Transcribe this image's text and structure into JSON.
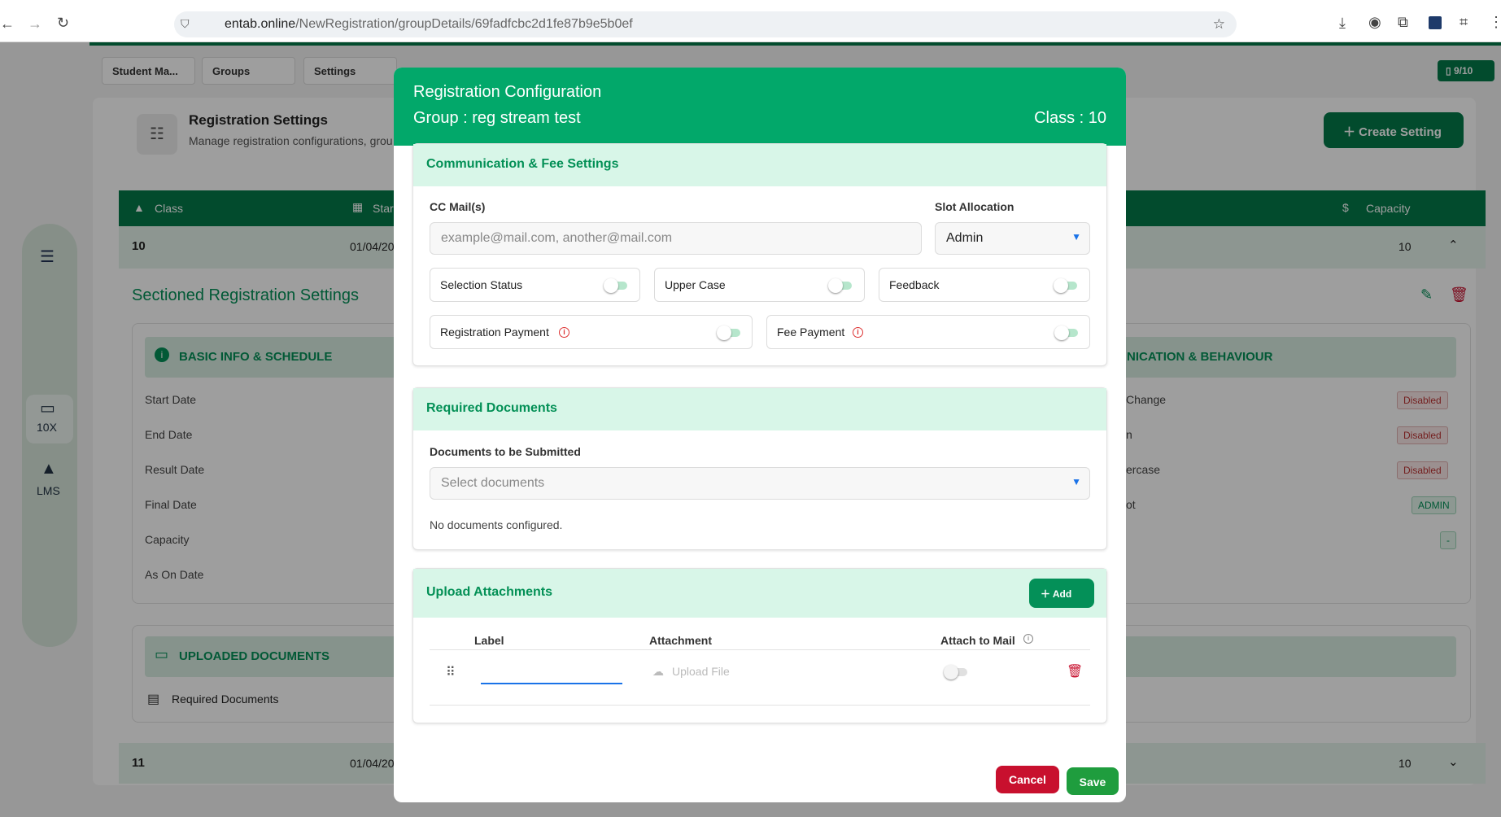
{
  "browser": {
    "url_host": "entab.online",
    "url_path": "/NewRegistration/groupDetails/69fadfcbc2d1fe87b9e5b0ef"
  },
  "topnav": {
    "tabs": [
      "Student Ma...",
      "Groups",
      "Settings"
    ],
    "page_badge": "9/10"
  },
  "sidebar": {
    "items": [
      {
        "label": "10X",
        "icon": "monitor-icon"
      },
      {
        "label": "LMS",
        "icon": "graduation-cap-icon"
      }
    ]
  },
  "page": {
    "title": "Registration Settings",
    "subtitle": "Manage registration configurations, grou",
    "create_button": "Create Setting",
    "table_headers": {
      "class": "Class",
      "start": "Star",
      "capacity": "Capacity"
    },
    "rows": [
      {
        "class": "10",
        "date": "01/04/20",
        "capacity": "10"
      },
      {
        "class": "11",
        "date": "01/04/20",
        "capacity": "10"
      }
    ],
    "sectioned_title": "Sectioned Registration Settings",
    "basic_info_title": "BASIC INFO & SCHEDULE",
    "basic_fields": [
      "Start Date",
      "End Date",
      "Result Date",
      "Final Date",
      "Capacity",
      "As On Date"
    ],
    "comm_title": "NICATION & BEHAVIOUR",
    "comm_fields": [
      {
        "label": "Change",
        "value": "Disabled"
      },
      {
        "label": "n",
        "value": "Disabled"
      },
      {
        "label": "ercase",
        "value": "Disabled"
      },
      {
        "label": "ot",
        "value": "ADMIN"
      },
      {
        "label": "",
        "value": "-"
      }
    ],
    "uploaded_title": "UPLOADED DOCUMENTS",
    "uploaded_item": "Required Documents"
  },
  "modal": {
    "title": "Registration Configuration",
    "group": "Group : reg stream test",
    "class": "Class : 10",
    "comm_section": {
      "title": "Communication & Fee Settings",
      "cc_label": "CC Mail(s)",
      "cc_placeholder": "example@mail.com, another@mail.com",
      "slot_label": "Slot Allocation",
      "slot_value": "Admin",
      "toggles": [
        {
          "label": "Selection Status",
          "on": false
        },
        {
          "label": "Upper Case",
          "on": false
        },
        {
          "label": "Feedback",
          "on": false
        },
        {
          "label": "Registration Payment",
          "on": false
        },
        {
          "label": "Fee Payment",
          "on": false
        }
      ]
    },
    "docs_section": {
      "title": "Required Documents",
      "label": "Documents to be Submitted",
      "placeholder": "Select documents",
      "empty_text": "No documents configured."
    },
    "upload_section": {
      "title": "Upload Attachments",
      "add_button": "Add",
      "columns": [
        "Label",
        "Attachment",
        "Attach to Mail"
      ],
      "row": {
        "label_value": "",
        "upload_text": "Upload File",
        "attach_on": false
      }
    },
    "cancel_button": "Cancel",
    "save_button": "Save"
  },
  "colors": {
    "primary": "#02a86a",
    "header_dark": "#047a4a",
    "danger": "#c8102e",
    "save": "#1f9d3e"
  }
}
